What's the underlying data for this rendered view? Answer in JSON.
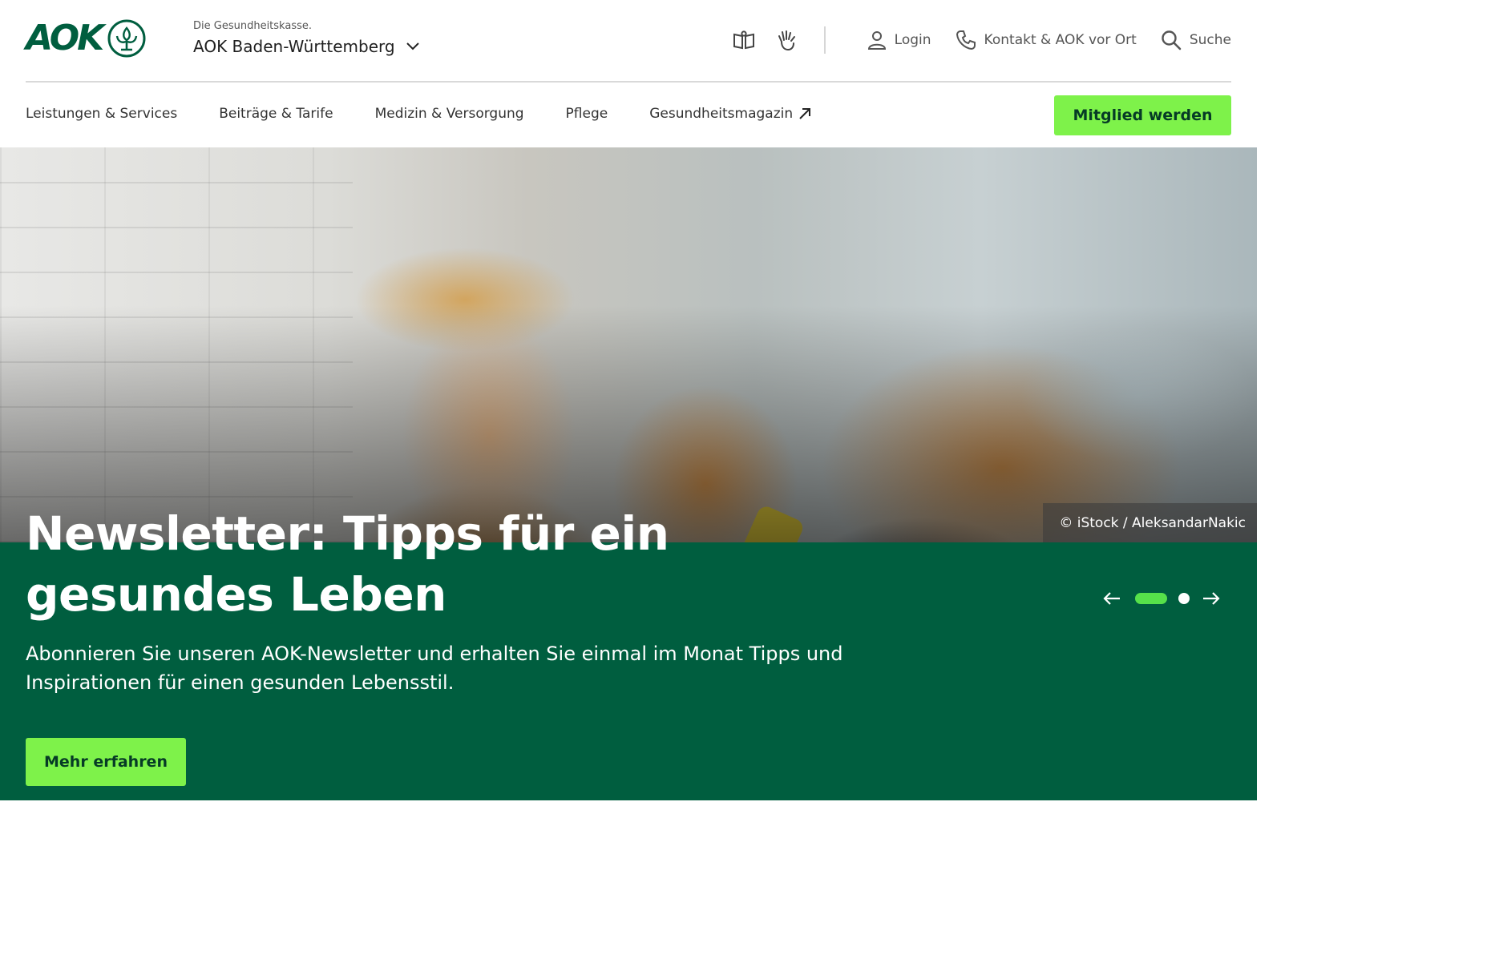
{
  "header": {
    "logo_text": "AOK",
    "brand_tagline": "Die Gesundheitskasse.",
    "brand_region": "AOK Baden-Württemberg",
    "icons": [
      "book-open-icon",
      "sign-language-hand-icon"
    ],
    "login_label": "Login",
    "contact_label": "Kontakt & AOK vor Ort",
    "search_label": "Suche"
  },
  "nav": {
    "items": [
      {
        "label": "Leistungen & Services"
      },
      {
        "label": "Beiträge & Tarife"
      },
      {
        "label": "Medizin & Versorgung"
      },
      {
        "label": "Pflege"
      },
      {
        "label": "Gesundheitsmagazin",
        "external": true
      }
    ],
    "cta_label": "Mitglied werden"
  },
  "hero": {
    "image_credit": "© iStock / AleksandarNakic",
    "headline": "Newsletter: Tipps für ein gesundes Leben",
    "body": "Abonnieren Sie unseren AOK-Newsletter und erhalten Sie einmal im Monat Tipps und Inspirationen für einen gesunden Lebensstil.",
    "cta_label": "Mehr erfahren",
    "carousel": {
      "total_slides": 2,
      "active_slide": 1
    }
  },
  "colors": {
    "brand_green": "#005e3f",
    "accent_green": "#7ef24a",
    "active_dot": "#56e14a"
  }
}
